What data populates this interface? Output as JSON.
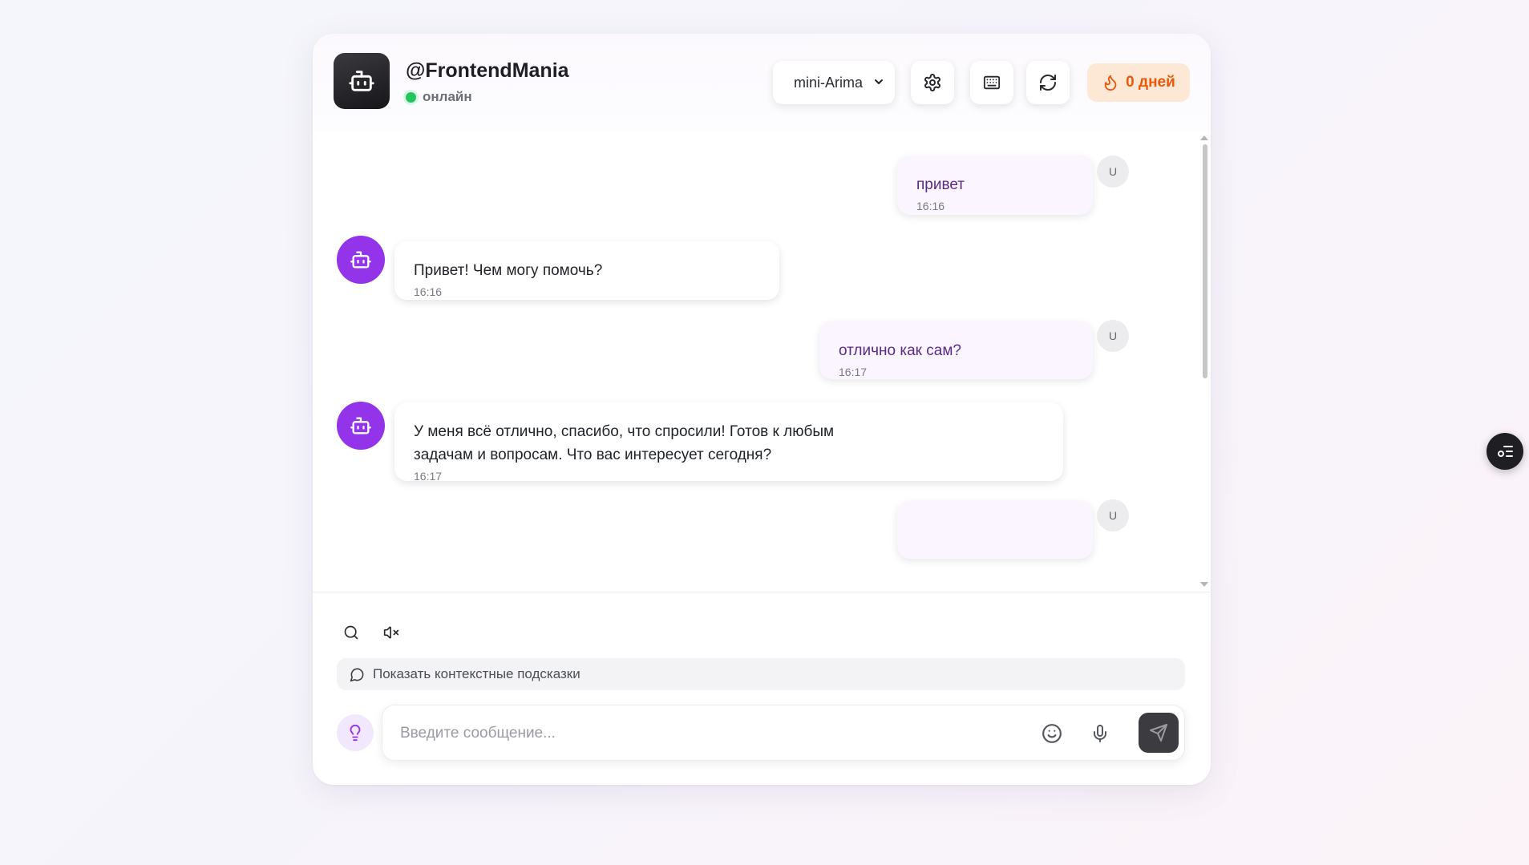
{
  "header": {
    "title": "@FrontendMania",
    "status": "онлайн",
    "model_selected": "mini-Arima",
    "streak_label": "0 дней"
  },
  "messages": [
    {
      "role": "user",
      "text": "привет",
      "time": "16:16",
      "avatar": "U"
    },
    {
      "role": "bot",
      "text": "Привет! Чем могу помочь?",
      "time": "16:16"
    },
    {
      "role": "user",
      "text": "отлично как сам?",
      "time": "16:17",
      "avatar": "U"
    },
    {
      "role": "bot",
      "text_line1": "У меня всё отлично, спасибо, что спросили! Готов к любым",
      "text_line2": "задачам и вопросам. Что вас интересует сегодня?",
      "time": "16:17"
    },
    {
      "role": "user",
      "avatar": "U"
    }
  ],
  "composer": {
    "hints_label": "Показать контекстные подсказки",
    "placeholder": "Введите сообщение..."
  },
  "colors": {
    "accent_purple": "#9333ea",
    "online_green": "#22c55e",
    "streak_orange": "#ea580c",
    "user_bubble": "#faf5fe"
  },
  "icons": {
    "logo": "bot-icon",
    "settings": "gear-icon",
    "keyboard": "keyboard-icon",
    "refresh": "refresh-icon",
    "streak": "flame-icon",
    "search": "search-icon",
    "mute": "volume-mute-icon",
    "hints": "message-circle-icon",
    "idea": "lightbulb-icon",
    "emoji": "smile-icon",
    "mic": "microphone-icon",
    "send": "send-icon",
    "floating": "list-settings-icon"
  }
}
